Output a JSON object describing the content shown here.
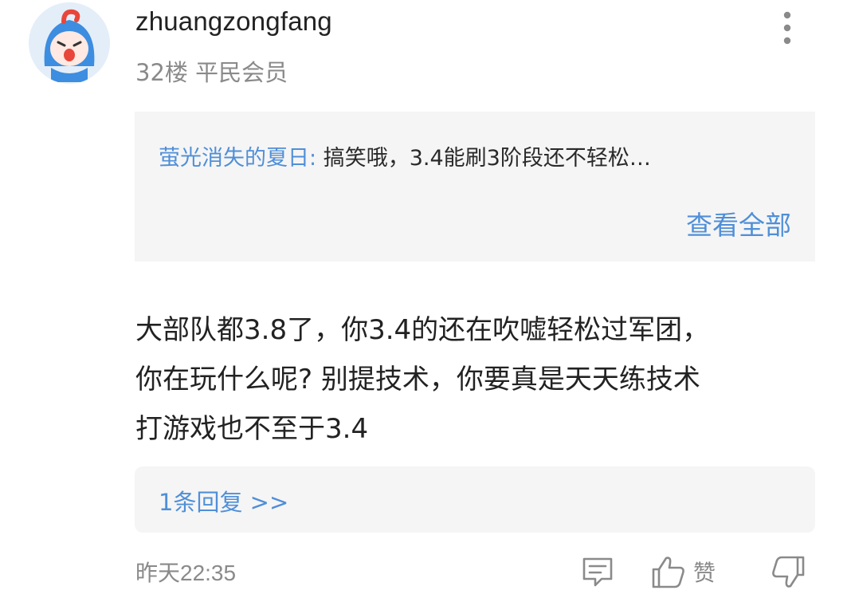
{
  "user": {
    "name": "zhuangzongfang",
    "floor": "32楼",
    "rank": "平民会员"
  },
  "quote": {
    "author": "萤光消失的夏日:",
    "text": "搞笑哦，3.4能刷3阶段还不轻松…",
    "view_all": "查看全部"
  },
  "comment": {
    "lines": [
      "大部队都3.8了，你3.4的还在吹嘘轻松过军团，",
      "你在玩什么呢? 别提技术，你要真是天天练技术",
      "打游戏也不至于3.4"
    ]
  },
  "replies": {
    "label": "1条回复 >>"
  },
  "footer": {
    "timestamp": "昨天22:35",
    "like_label": "赞"
  },
  "colors": {
    "link": "#4f8fd8",
    "muted": "#8a8a8a",
    "panel": "#f5f5f5"
  },
  "icons": {
    "avatar": "cartoon-avatar",
    "more": "more-vertical-icon",
    "reply": "comment-icon",
    "like": "thumbs-up-icon",
    "dislike": "thumbs-down-icon"
  }
}
